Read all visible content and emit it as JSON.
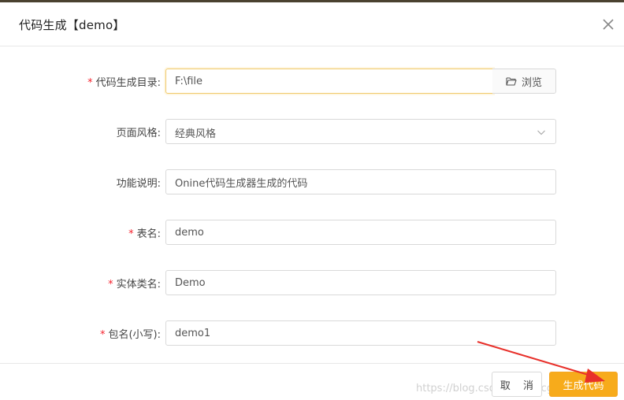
{
  "dialog": {
    "title": "代码生成【demo】"
  },
  "form": {
    "output_dir": {
      "label": "代码生成目录:",
      "value": "F:\\file",
      "required": true
    },
    "browse_label": "浏览",
    "style": {
      "label": "页面风格:",
      "value": "经典风格"
    },
    "description": {
      "label": "功能说明:",
      "value": "Onine代码生成器生成的代码"
    },
    "table_name": {
      "label": "表名:",
      "value": "demo",
      "required": true
    },
    "entity_name": {
      "label": "实体类名:",
      "value": "Demo",
      "required": true
    },
    "package_name": {
      "label": "包名(小写):",
      "value": "demo1",
      "required": true
    }
  },
  "footer": {
    "cancel_label": "取 消",
    "generate_label": "生成代码",
    "watermark": "https://blog.csdn.net/jeecg"
  },
  "colors": {
    "primary_button": "#f7ab1b",
    "required_star": "#f5222d",
    "annotation_arrow": "#e8302a"
  },
  "icons": {
    "close": "close-icon",
    "browse": "folder-open-icon",
    "select": "chevron-down-icon"
  }
}
